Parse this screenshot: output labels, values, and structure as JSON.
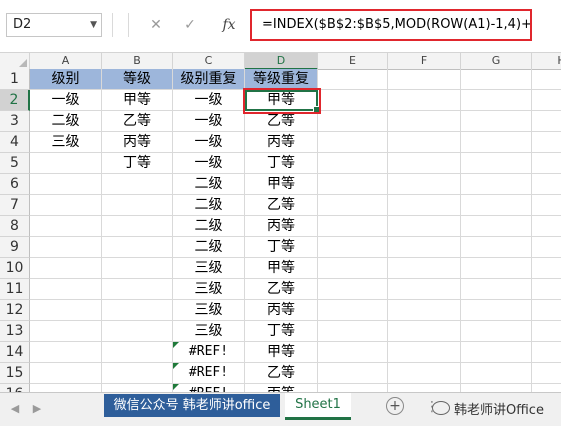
{
  "formula_bar": {
    "name_box": "D2",
    "cancel_icon": "✕",
    "enter_icon": "✓",
    "fx_label": "fx",
    "formula": "=INDEX($B$2:$B$5,MOD(ROW(A1)-1,4)+1)"
  },
  "columns": [
    "A",
    "B",
    "C",
    "D",
    "E",
    "F",
    "G",
    "H"
  ],
  "selected_column": "D",
  "selected_cell": "D2",
  "rows": [
    {
      "n": "1",
      "a": "级别",
      "b": "等级",
      "c": "级别重复",
      "d": "等级重复"
    },
    {
      "n": "2",
      "a": "一级",
      "b": "甲等",
      "c": "一级",
      "d": "甲等"
    },
    {
      "n": "3",
      "a": "二级",
      "b": "乙等",
      "c": "一级",
      "d": "乙等"
    },
    {
      "n": "4",
      "a": "三级",
      "b": "丙等",
      "c": "一级",
      "d": "丙等"
    },
    {
      "n": "5",
      "a": "",
      "b": "丁等",
      "c": "一级",
      "d": "丁等"
    },
    {
      "n": "6",
      "a": "",
      "b": "",
      "c": "二级",
      "d": "甲等"
    },
    {
      "n": "7",
      "a": "",
      "b": "",
      "c": "二级",
      "d": "乙等"
    },
    {
      "n": "8",
      "a": "",
      "b": "",
      "c": "二级",
      "d": "丙等"
    },
    {
      "n": "9",
      "a": "",
      "b": "",
      "c": "二级",
      "d": "丁等"
    },
    {
      "n": "10",
      "a": "",
      "b": "",
      "c": "三级",
      "d": "甲等"
    },
    {
      "n": "11",
      "a": "",
      "b": "",
      "c": "三级",
      "d": "乙等"
    },
    {
      "n": "12",
      "a": "",
      "b": "",
      "c": "三级",
      "d": "丙等"
    },
    {
      "n": "13",
      "a": "",
      "b": "",
      "c": "三级",
      "d": "丁等"
    },
    {
      "n": "14",
      "a": "",
      "b": "",
      "c": "#REF!",
      "d": "甲等"
    },
    {
      "n": "15",
      "a": "",
      "b": "",
      "c": "#REF!",
      "d": "乙等"
    },
    {
      "n": "16",
      "a": "",
      "b": "",
      "c": "#REF!",
      "d": "丙等"
    }
  ],
  "colors": {
    "header_fill": "#9db6db",
    "selection": "#217346",
    "highlight_red": "#e0262d",
    "error_indicator": "#1f7a3a",
    "wechat_tab": "#2e5e9a"
  },
  "tabs": {
    "nav_prev": "◀",
    "nav_next": "▶",
    "wechat_tab": "微信公众号 韩老师讲office",
    "sheet1": "Sheet1",
    "add_icon": "+",
    "more": "⋮",
    "watermark": "韩老师讲Office"
  }
}
